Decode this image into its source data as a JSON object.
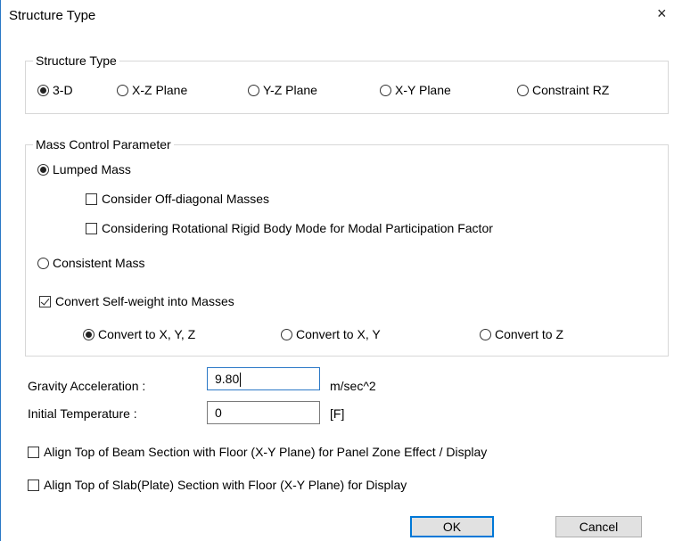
{
  "window": {
    "title": "Structure Type",
    "close_glyph": "×"
  },
  "structure_type": {
    "label": "Structure Type",
    "options": [
      "3-D",
      "X-Z Plane",
      "Y-Z Plane",
      "X-Y Plane",
      "Constraint RZ"
    ],
    "selected": "3-D"
  },
  "mass_control": {
    "label": "Mass Control Parameter",
    "lumped_mass": "Lumped Mass",
    "off_diagonal": "Consider Off-diagonal Masses",
    "rotational_mode": "Considering Rotational Rigid Body Mode for Modal Participation Factor",
    "consistent_mass": "Consistent Mass",
    "convert_selfweight": "Convert Self-weight into Masses",
    "convert_options": [
      "Convert to X, Y, Z",
      "Convert to X, Y",
      "Convert to Z"
    ],
    "selected_mass": "Lumped Mass",
    "selected_convert": "Convert to X, Y, Z",
    "off_diagonal_checked": false,
    "rotational_checked": false,
    "convert_checked": true
  },
  "gravity": {
    "label": "Gravity Acceleration :",
    "value": "9.80",
    "unit": "m/sec^2"
  },
  "temperature": {
    "label": "Initial Temperature :",
    "value": "0",
    "unit": "[F]"
  },
  "align_beam": {
    "label": "Align Top of Beam Section with Floor (X-Y Plane) for Panel Zone Effect / Display",
    "checked": false
  },
  "align_slab": {
    "label": "Align Top of Slab(Plate) Section with Floor (X-Y Plane) for Display",
    "checked": false
  },
  "buttons": {
    "ok": "OK",
    "cancel": "Cancel"
  }
}
